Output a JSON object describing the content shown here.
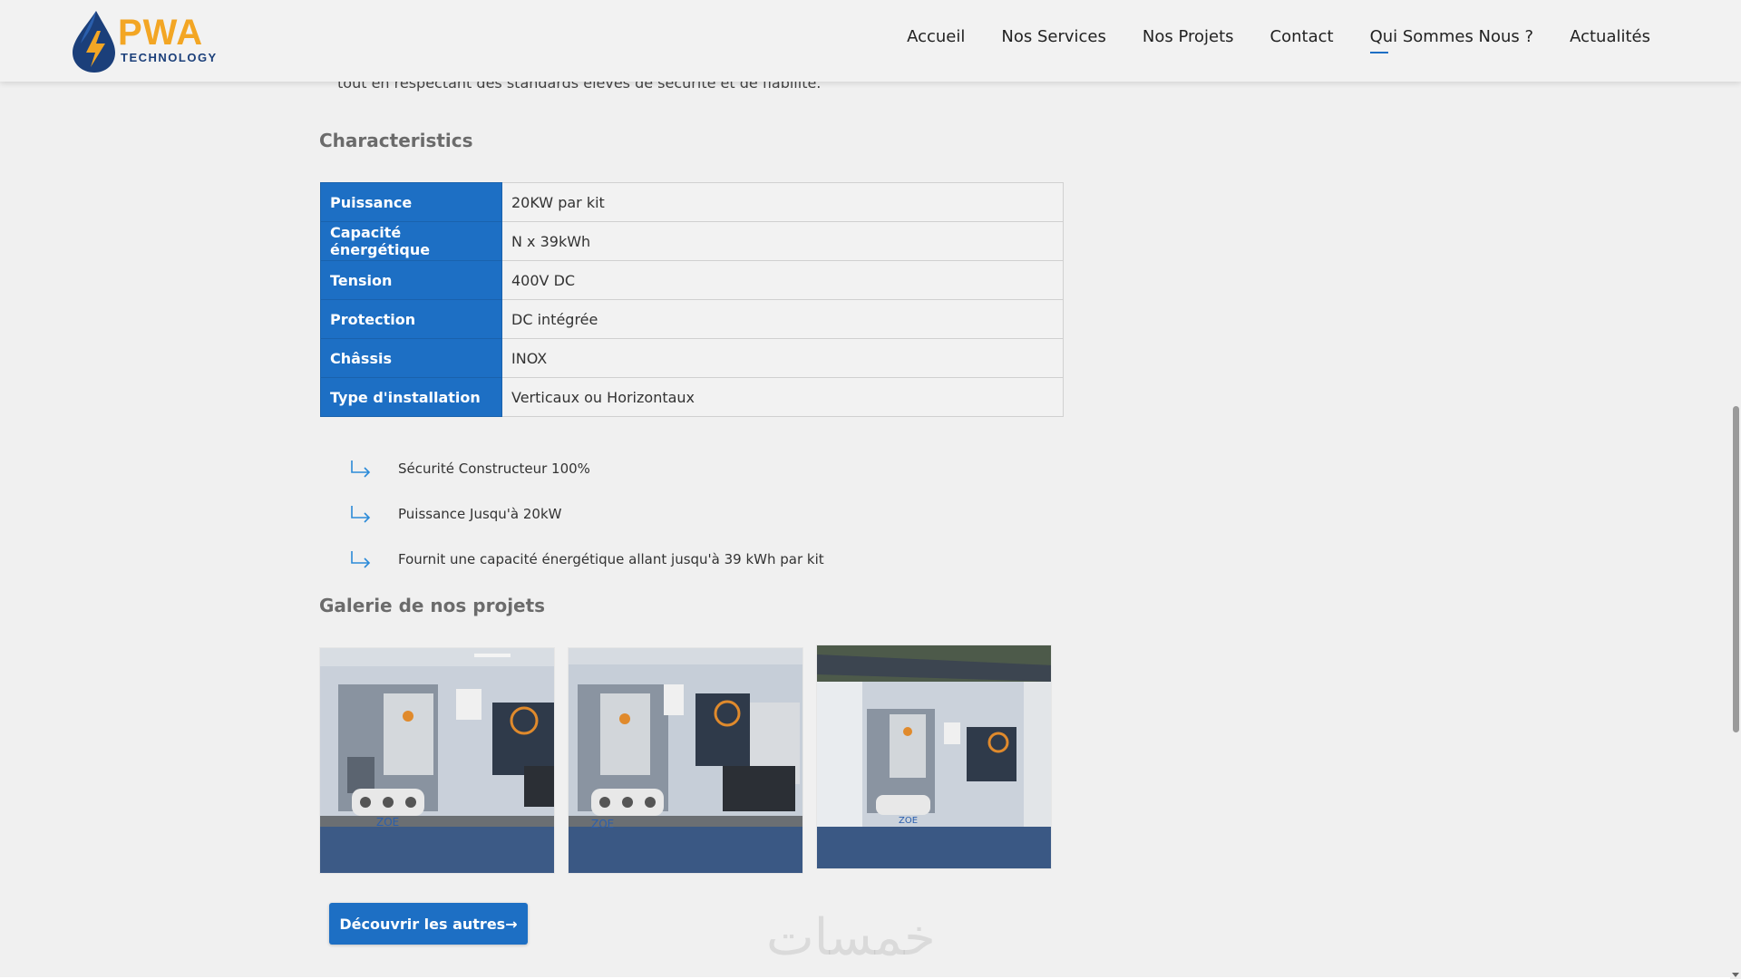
{
  "brand": {
    "name": "PWA",
    "subtitle": "TECHNOLOGY",
    "accent": "#1d6fc4",
    "logo_colors": [
      "#1b3f7a",
      "#f3a624",
      "#2a5fae"
    ]
  },
  "nav": {
    "items": [
      {
        "label": "Accueil"
      },
      {
        "label": "Nos Services"
      },
      {
        "label": "Nos Projets"
      },
      {
        "label": "Contact"
      },
      {
        "label": "Qui Sommes Nous ?",
        "active": true
      },
      {
        "label": "Actualités"
      }
    ]
  },
  "intro": "tout en respectant des standards élevés de sécurité et de fiabilité.",
  "characteristics": {
    "title": "Characteristics",
    "rows": [
      {
        "key": "Puissance",
        "value": "20KW par kit"
      },
      {
        "key": "Capacité énergétique",
        "value": "N x 39kWh"
      },
      {
        "key": "Tension",
        "value": "400V DC"
      },
      {
        "key": "Protection",
        "value": "DC intégrée"
      },
      {
        "key": "Châssis",
        "value": "INOX"
      },
      {
        "key": "Type d'installation",
        "value": "Verticaux ou Horizontaux"
      }
    ]
  },
  "features": [
    {
      "icon": "arrow-return-icon",
      "text": "Sécurité Constructeur 100%"
    },
    {
      "icon": "arrow-return-icon",
      "text": "Puissance Jusqu'à 20kW"
    },
    {
      "icon": "arrow-return-icon",
      "text": "Fournit une capacité énergétique allant jusqu'à 39 kWh par kit"
    }
  ],
  "gallery": {
    "title": "Galerie de nos projets",
    "photos": [
      {
        "label": "ZOE"
      },
      {
        "label": "ZOE"
      },
      {
        "label": "ZOE"
      }
    ]
  },
  "cta": {
    "label": "Découvrir les autres→"
  },
  "watermark": "خمسات"
}
